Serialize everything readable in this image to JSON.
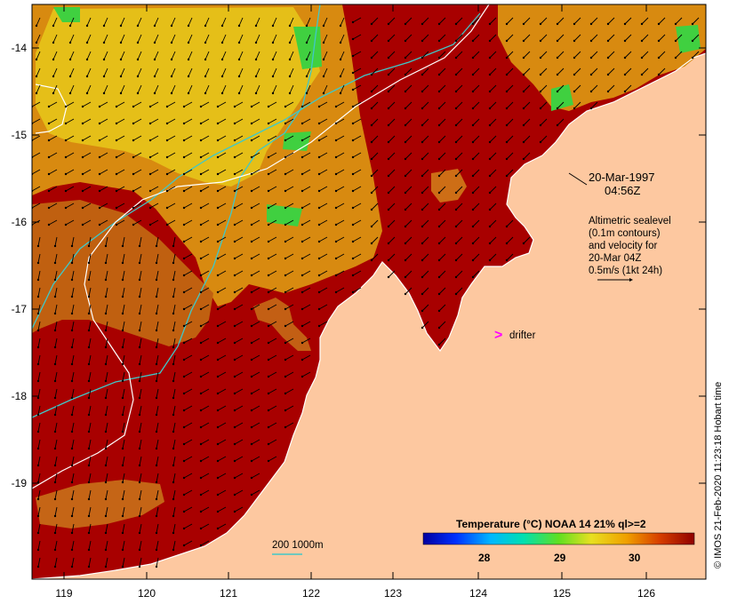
{
  "map": {
    "x_ticks": [
      "119",
      "120",
      "121",
      "122",
      "123",
      "124",
      "125",
      "126"
    ],
    "y_ticks": [
      "-14",
      "-15",
      "-16",
      "-17",
      "-18",
      "-19"
    ],
    "annotation": {
      "date": "20-Mar-1997",
      "time": "04:56Z",
      "sealevel_lines": [
        "Altimetric sealevel",
        "(0.1m contours)",
        "and velocity for",
        "20-Mar 04Z",
        "0.5m/s (1kt 24h)"
      ]
    },
    "drifter": {
      "symbol": ">",
      "label": "drifter",
      "color": "#ff00ff"
    },
    "bathymetry": {
      "label": "200  1000m",
      "color": "#40c8c8"
    },
    "legend": {
      "title": "Temperature (°C) NOAA 14 21% ql>=2",
      "ticks": [
        "28",
        "29",
        "30"
      ]
    },
    "credit": "© IMOS 21-Feb-2020 11:23:18 Hobart time",
    "colors": {
      "land": "#fdc8a0",
      "sst_hot": "#a80000",
      "sst_warm": "#d88a10",
      "sst_yellow": "#e8c81a",
      "contour": "#ffffff",
      "isobath": "#40c8c8"
    }
  }
}
